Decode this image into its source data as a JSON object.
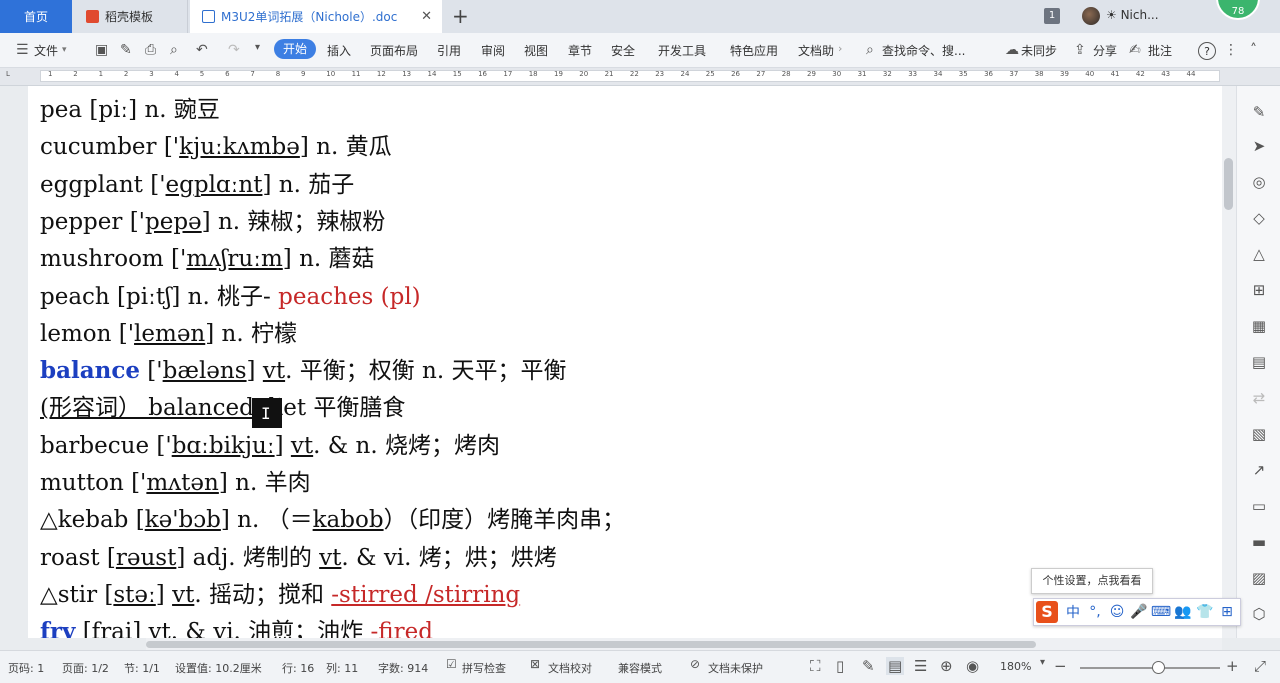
{
  "titlebar": {
    "tab_home": "首页",
    "tab_template": "稻壳模板",
    "tab_document": "M3U2单词拓展（Nichole）.doc",
    "close_glyph": "✕",
    "add_glyph": "+",
    "window_count": "1",
    "user_name": "☀ Nich...",
    "score": "78"
  },
  "ribbon": {
    "file": "文件",
    "tabs": [
      "开始",
      "插入",
      "页面布局",
      "引用",
      "审阅",
      "视图",
      "章节",
      "安全",
      "开发工具",
      "特色应用",
      "文档助"
    ],
    "search": "查找命令、搜...",
    "sync": "未同步",
    "share": "分享",
    "annotate": "批注",
    "help": "?"
  },
  "ruler": {
    "ticks": [
      "L",
      "1",
      "2",
      "1",
      "2",
      "3",
      "4",
      "5",
      "6",
      "7",
      "8",
      "9",
      "10",
      "11",
      "12",
      "13",
      "14",
      "15",
      "16",
      "17",
      "18",
      "19",
      "20",
      "21",
      "22",
      "23",
      "24",
      "25",
      "26",
      "27",
      "28",
      "29",
      "30",
      "31",
      "32",
      "33",
      "34",
      "35",
      "36",
      "37",
      "38",
      "39",
      "40",
      "41",
      "42",
      "43",
      "44"
    ]
  },
  "document": {
    "lines": [
      [
        {
          "t": "pea [piː] n. 豌豆"
        }
      ],
      [
        {
          "t": "cucumber ['"
        },
        {
          "t": "kjuːkʌmbə",
          "ul": true
        },
        {
          "t": "] n. 黄瓜"
        }
      ],
      [
        {
          "t": "eggplant ['"
        },
        {
          "t": "egplɑːnt",
          "ul": true
        },
        {
          "t": "] n. 茄子"
        }
      ],
      [
        {
          "t": "pepper ['"
        },
        {
          "t": "pepə",
          "ul": true
        },
        {
          "t": "] n. 辣椒；辣椒粉"
        }
      ],
      [
        {
          "t": "mushroom ['"
        },
        {
          "t": "mʌʃruːm",
          "ul": true
        },
        {
          "t": "] n. 蘑菇"
        }
      ],
      [
        {
          "t": "peach [piːtʃ] n. 桃子-   "
        },
        {
          "t": "peaches (pl)",
          "c": "red"
        }
      ],
      [
        {
          "t": "lemon ['"
        },
        {
          "t": "lemən",
          "ul": true
        },
        {
          "t": "] n. 柠檬"
        }
      ],
      [
        {
          "t": "balance",
          "c": "blue"
        },
        {
          "t": " ['"
        },
        {
          "t": "bæləns",
          "ul": true
        },
        {
          "t": "] "
        },
        {
          "t": "vt",
          "ul": true
        },
        {
          "t": ". 平衡；权衡 n. 天平；平衡"
        }
      ],
      [
        {
          "t": "(形容词） balanced",
          "ul": true
        },
        {
          "t": " diet 平衡膳食"
        }
      ],
      [
        {
          "t": "barbecue ['"
        },
        {
          "t": "bɑːbikjuː",
          "ul": true
        },
        {
          "t": "] "
        },
        {
          "t": "vt",
          "ul": true
        },
        {
          "t": ". & n. 烧烤；烤肉"
        }
      ],
      [
        {
          "t": "mutton ['"
        },
        {
          "t": "mʌtən",
          "ul": true
        },
        {
          "t": "] n. 羊肉"
        }
      ],
      [
        {
          "t": "△kebab ["
        },
        {
          "t": "kə'bɔb",
          "ul": true
        },
        {
          "t": "] n. （＝"
        },
        {
          "t": "kabob",
          "ul": true
        },
        {
          "t": "）（印度）烤腌羊肉串；"
        }
      ],
      [
        {
          "t": "roast ["
        },
        {
          "t": "rəust",
          "ul": true
        },
        {
          "t": "] adj. 烤制的 "
        },
        {
          "t": "vt",
          "ul": true
        },
        {
          "t": ". & vi. 烤；烘；烘烤"
        }
      ],
      [
        {
          "t": "△stir ["
        },
        {
          "t": "stəː",
          "ul": true
        },
        {
          "t": "] "
        },
        {
          "t": "vt",
          "ul": true
        },
        {
          "t": ". 摇动；搅和 "
        },
        {
          "t": "-stirred /stirring",
          "c": "red",
          "ul": true
        }
      ],
      [
        {
          "t": "fry",
          "c": "blue"
        },
        {
          "t": " [frai] "
        },
        {
          "t": "vt",
          "ul": true
        },
        {
          "t": ". & vi. 油煎；油炸 "
        },
        {
          "t": "-fired",
          "c": "red"
        }
      ]
    ],
    "caret": "I"
  },
  "ime": {
    "tooltip": "个性设置，点我看看",
    "logo": "S",
    "buttons": [
      "中",
      "°,",
      "☺",
      "🎤",
      "⌨",
      "👥",
      "👕",
      "⊞"
    ]
  },
  "statusbar": {
    "page_code": "页码: 1",
    "page": "页面: 1/2",
    "section": "节: 1/1",
    "setting": "设置值: 10.2厘米",
    "row": "行: 16",
    "col": "列: 11",
    "words": "字数: 914",
    "spell": "拼写检查",
    "proof": "文档校对",
    "compat": "兼容模式",
    "protect": "文档未保护",
    "zoom": "180%"
  }
}
